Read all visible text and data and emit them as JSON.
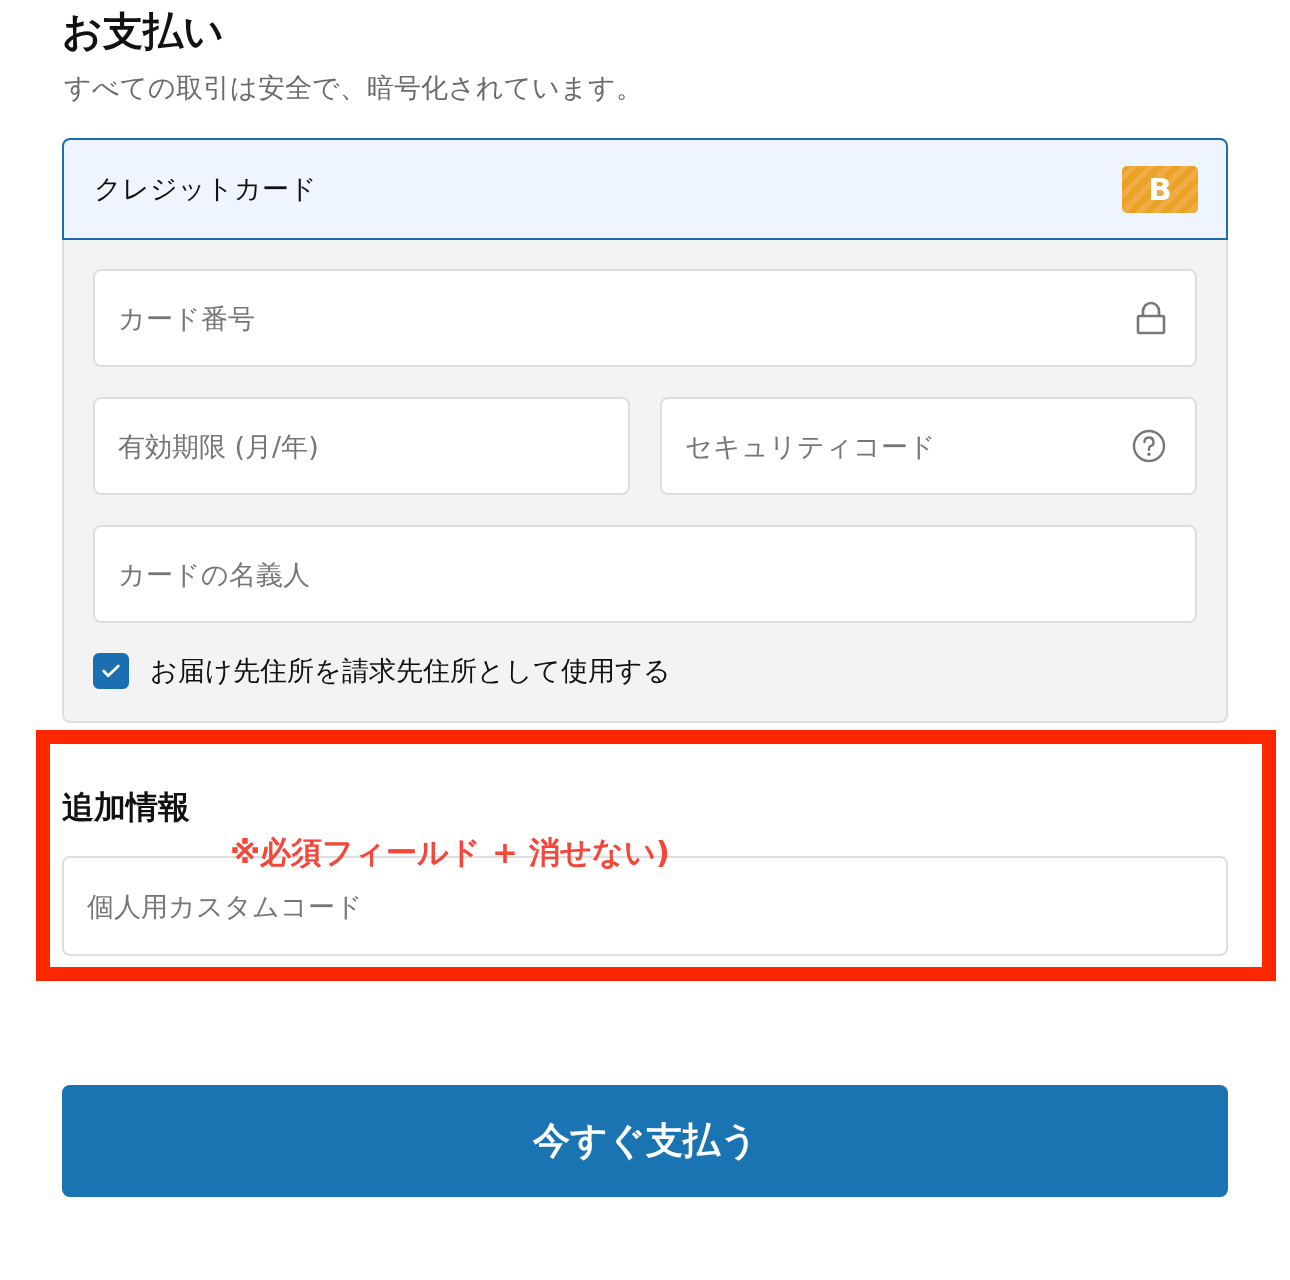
{
  "payment": {
    "title": "お支払い",
    "subtitle": "すべての取引は安全で、暗号化されています。"
  },
  "card_method": {
    "label": "クレジットカード",
    "selected": true,
    "badge": "B",
    "rows": [
      {
        "fields": [
          {
            "kind": "card_number",
            "placeholder": "カード番号"
          }
        ]
      },
      {
        "fields": [
          {
            "kind": "expiry",
            "placeholder": "有効期限 (月/年)"
          },
          {
            "kind": "security_code",
            "placeholder": "セキュリティコード"
          }
        ]
      },
      {
        "fields": [
          {
            "kind": "cardholder",
            "placeholder": "カードの名義人"
          }
        ]
      }
    ],
    "billing_checkbox": {
      "label": "お届け先住所を請求先住所として使用する",
      "checked": true
    }
  },
  "additional_info": {
    "heading": "追加情報",
    "field": {
      "placeholder": "個人用カスタムコード"
    },
    "annotation": {
      "text": "※必須フィールド + 消せない)"
    }
  },
  "pay_button": {
    "label": "今すぐ支払う"
  }
}
